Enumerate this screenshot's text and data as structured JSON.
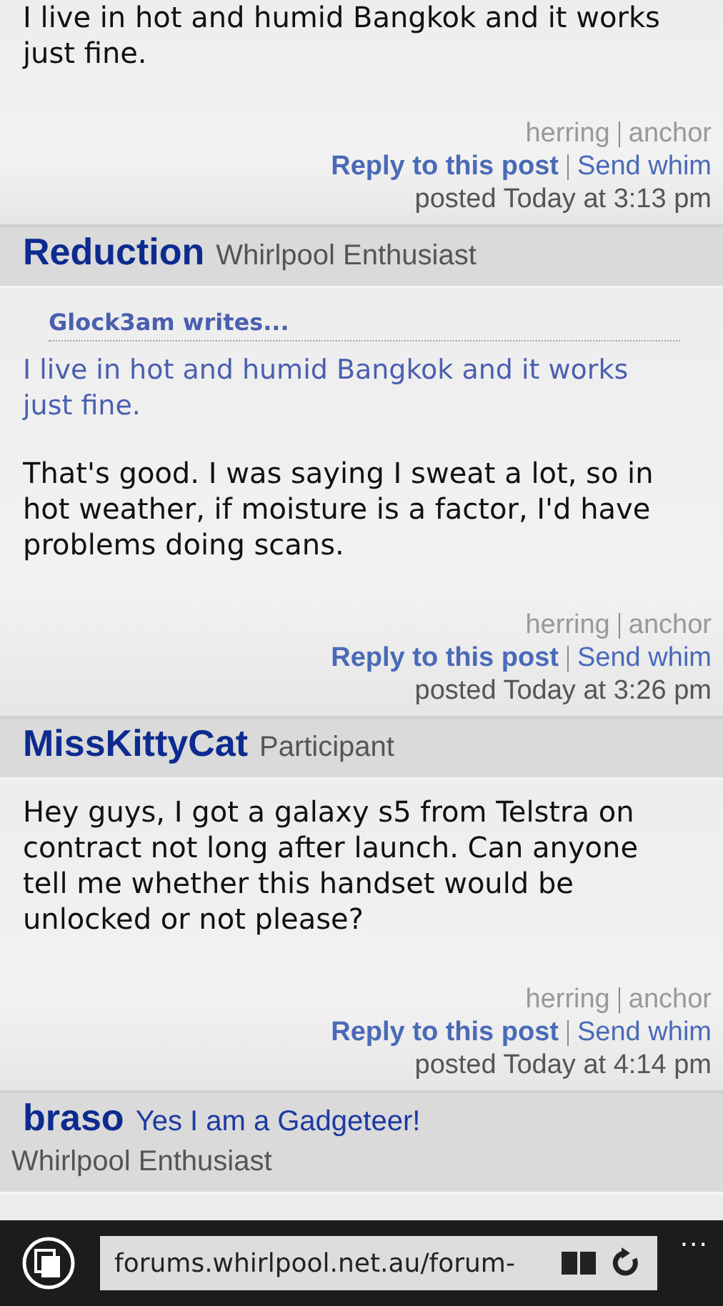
{
  "posts": [
    {
      "body": "I live in hot and humid Bangkok and it works just fine.",
      "links": {
        "herring": "herring",
        "anchor": "anchor",
        "reply": "Reply to this post",
        "whim": "Send whim"
      },
      "posted": "posted Today at 3:13 pm"
    },
    {
      "author": "Reduction",
      "role": "Whirlpool Enthusiast",
      "quote": {
        "by": "Glock3am writes...",
        "text": "I live in hot and humid Bangkok and it works just fine."
      },
      "body": "That's good. I was saying I sweat a lot, so in hot weather, if moisture is a factor, I'd have problems doing scans.",
      "links": {
        "herring": "herring",
        "anchor": "anchor",
        "reply": "Reply to this post",
        "whim": "Send whim"
      },
      "posted": "posted Today at 3:26 pm"
    },
    {
      "author": "MissKittyCat",
      "role": "Participant",
      "body": "Hey guys, I got a galaxy s5 from Telstra on contract not long after launch. Can anyone tell me whether this handset would be unlocked or not please?",
      "links": {
        "herring": "herring",
        "anchor": "anchor",
        "reply": "Reply to this post",
        "whim": "Send whim"
      },
      "posted": "posted Today at 4:14 pm"
    },
    {
      "author": "braso",
      "tagline": "Yes I am a Gadgeteer!",
      "role": "Whirlpool Enthusiast"
    }
  ],
  "browser": {
    "url": "forums.whirlpool.net.au/forum-",
    "more": "..."
  }
}
